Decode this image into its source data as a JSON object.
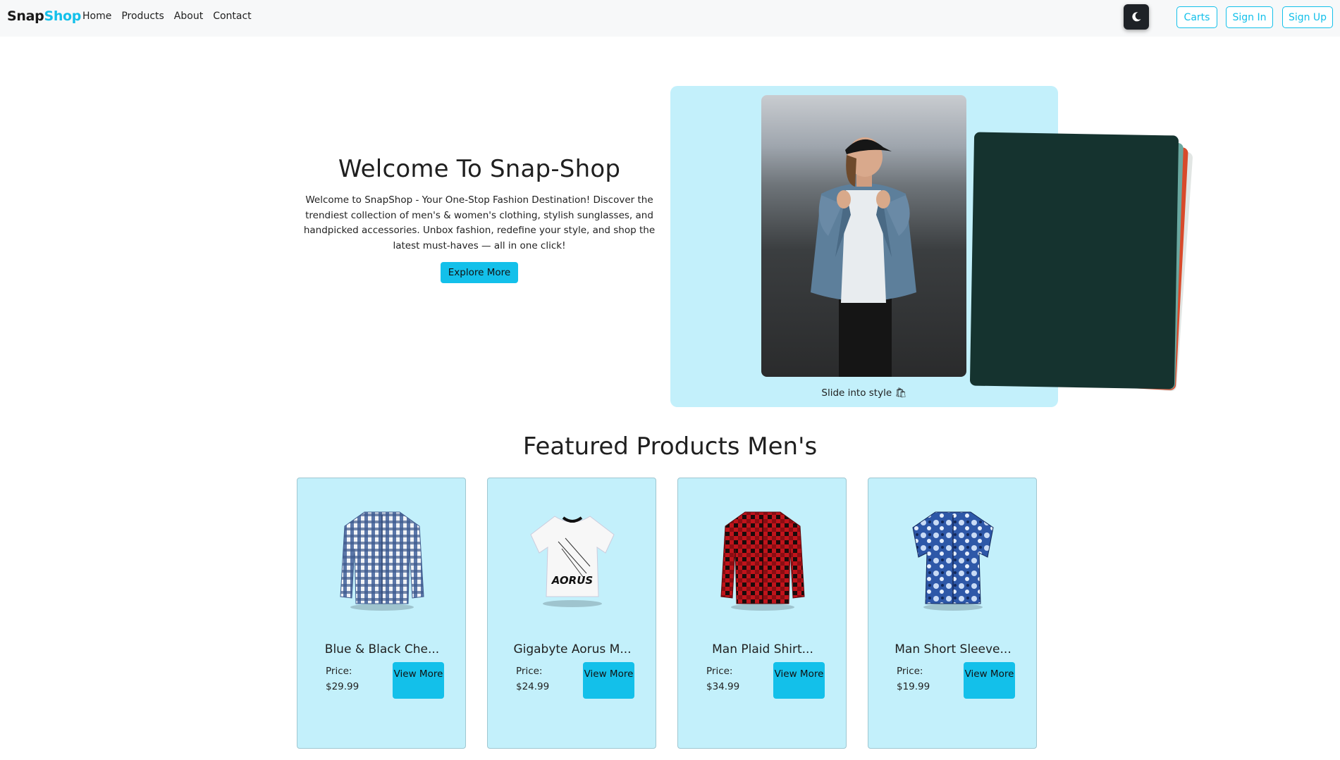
{
  "navbar": {
    "brand_part1": "Snap",
    "brand_part2": "Shop",
    "links": [
      "Home",
      "Products",
      "About",
      "Contact"
    ],
    "theme_icon": "moon-icon",
    "carts_label": "Carts",
    "signin_label": "Sign In",
    "signup_label": "Sign Up"
  },
  "hero": {
    "title": "Welcome To Snap-Shop",
    "description": "Welcome to SnapShop - Your One-Stop Fashion Destination! Discover the trendiest collection of men's & women's clothing, stylish sunglasses, and handpicked accessories. Unbox fashion, redefine your style, and shop the latest must-haves — all in one click!",
    "button_label": "Explore More",
    "slider_caption": "Slide into style 🛍"
  },
  "featured": {
    "title": "Featured Products Men's",
    "price_label": "Price:",
    "view_label": "View More",
    "products": [
      {
        "name": "Blue & Black Che...",
        "price": "$29.99",
        "icon": "checked-shirt-icon"
      },
      {
        "name": "Gigabyte Aorus M...",
        "price": "$24.99",
        "icon": "tshirt-icon"
      },
      {
        "name": "Man Plaid Shirt...",
        "price": "$34.99",
        "icon": "plaid-shirt-icon"
      },
      {
        "name": "Man Short Sleeve...",
        "price": "$19.99",
        "icon": "floral-shirt-icon"
      }
    ]
  },
  "colors": {
    "accent": "#13c0ea",
    "card_bg": "#c3f0fb",
    "navbar_bg": "#f7f8f9"
  }
}
